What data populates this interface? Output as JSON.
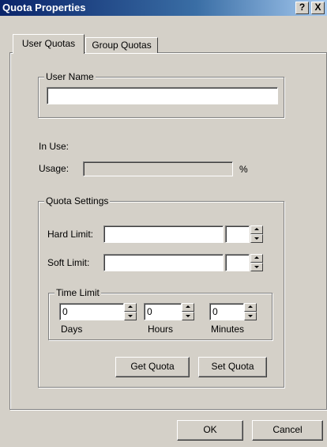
{
  "window": {
    "title": "Quota Properties",
    "help_glyph": "?",
    "close_glyph": "X"
  },
  "tabs": [
    {
      "label": "User Quotas",
      "selected": true
    },
    {
      "label": "Group Quotas",
      "selected": false
    }
  ],
  "user_group": {
    "title": "User Name",
    "value": ""
  },
  "in_use_label": "In Use:",
  "usage": {
    "label": "Usage:",
    "value": "",
    "unit": "%"
  },
  "quota_settings": {
    "title": "Quota Settings",
    "hard_limit": {
      "label": "Hard Limit:",
      "value": "",
      "unit_value": ""
    },
    "soft_limit": {
      "label": "Soft Limit:",
      "value": "",
      "unit_value": ""
    },
    "time_limit": {
      "title": "Time Limit",
      "days": {
        "value": "0",
        "label": "Days"
      },
      "hours": {
        "value": "0",
        "label": "Hours"
      },
      "minutes": {
        "value": "0",
        "label": "Minutes"
      }
    },
    "get_quota_label": "Get Quota",
    "set_quota_label": "Set Quota"
  },
  "footer": {
    "ok_label": "OK",
    "cancel_label": "Cancel"
  },
  "colors": {
    "face": "#d4d0c8",
    "title_start": "#0a246a",
    "title_end": "#a6caf0"
  }
}
